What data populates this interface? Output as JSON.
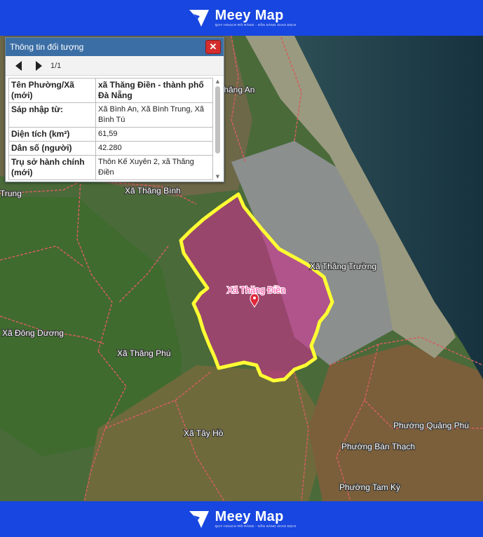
{
  "brand": {
    "name": "Meey Map",
    "tagline": "QUY HOẠCH RÕ RÀNG - SẴN SÀNG GIAO DỊCH"
  },
  "panel": {
    "title": "Thông tin đối tượng",
    "close_label": "✕",
    "page": "1/1",
    "rows": [
      {
        "key": "Tên Phường/Xã (mới)",
        "value": "xã Thăng Điền - thành phố Đà Nẵng",
        "value_bold": true
      },
      {
        "key": "Sáp nhập từ:",
        "value": "Xã Bình An, Xã Bình Trung, Xã Bình Tú"
      },
      {
        "key": "Diện tích (km²)",
        "value": "61,59"
      },
      {
        "key": "Dân số (người)",
        "value": "42.280"
      },
      {
        "key": "Trụ sở hành chính (mới)",
        "value": "Thôn Kế Xuyên 2, xã Thăng Điền"
      }
    ]
  },
  "map": {
    "labels": {
      "thang_an": "Thăng An",
      "trung": "Trung",
      "thang_binh": "Xã Thăng Bình",
      "thang_truong": "Xã Thăng Trường",
      "thang_dien": "Xã Thăng Điền",
      "dong_duong": "Xã Đông Dương",
      "thang_phu": "Xã Thăng Phú",
      "tay_ho": "Xã Tây Hồ",
      "quang_phu": "Phường Quảng Phú",
      "ban_thach": "Phường Bàn Thạch",
      "tam_ky": "Phường Tam Kỳ"
    },
    "colors": {
      "highlight_fill": "#c8318a",
      "highlight_border": "#ffff33",
      "boundary": "#d25f5f",
      "sea": "#1f3d4a"
    }
  }
}
